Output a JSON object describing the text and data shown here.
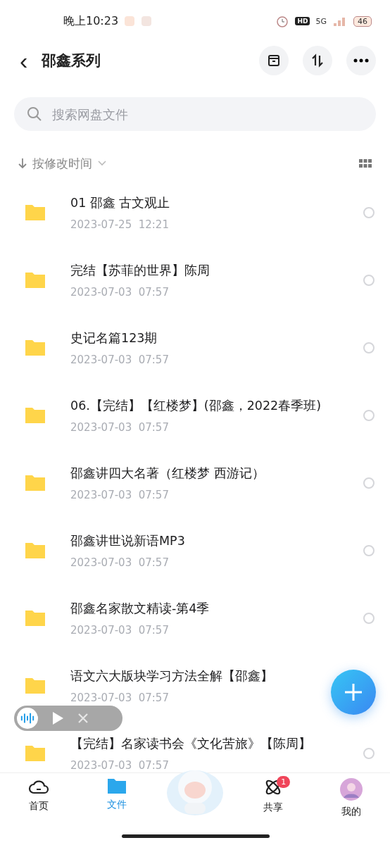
{
  "status_bar": {
    "time": "晚上10:23",
    "hd": "HD",
    "network": "5G",
    "battery": "46"
  },
  "header": {
    "back": "‹",
    "title": "邵鑫系列"
  },
  "search": {
    "placeholder": "搜索网盘文件"
  },
  "sort": {
    "label": "按修改时间"
  },
  "files": [
    {
      "name": "01 邵鑫 古文观止",
      "date": "2023-07-25  12:21",
      "selected": false
    },
    {
      "name": "完结【苏菲的世界】陈周",
      "date": "2023-07-03  07:57",
      "selected": false
    },
    {
      "name": "史记名篇123期",
      "date": "2023-07-03  07:57",
      "selected": false
    },
    {
      "name": "06.【完结】【红楼梦】(邵鑫，2022春季班)",
      "date": "2023-07-03  07:57",
      "selected": false
    },
    {
      "name": "邵鑫讲四大名著（红楼梦 西游记）",
      "date": "2023-07-03  07:57",
      "selected": false
    },
    {
      "name": "邵鑫讲世说新语MP3",
      "date": "2023-07-03  07:57",
      "selected": false
    },
    {
      "name": "邵鑫名家散文精读-第4季",
      "date": "2023-07-03  07:57",
      "selected": false
    },
    {
      "name": "语文六大版块学习方法全解【邵鑫】",
      "date": "2023-07-03  07:57"
    },
    {
      "name": "【完结】名家读书会《文化苦旅》【陈周】",
      "date": "2023-07-03  07:57",
      "selected": false
    }
  ],
  "nav": [
    {
      "kind": "home",
      "label": "首页",
      "selected": false
    },
    {
      "kind": "files",
      "label": "文件",
      "selected": true
    },
    {
      "kind": "mascot"
    },
    {
      "kind": "share",
      "label": "共享",
      "selected": false,
      "badge": "1"
    },
    {
      "kind": "me",
      "label": "我的",
      "selected": false
    }
  ]
}
